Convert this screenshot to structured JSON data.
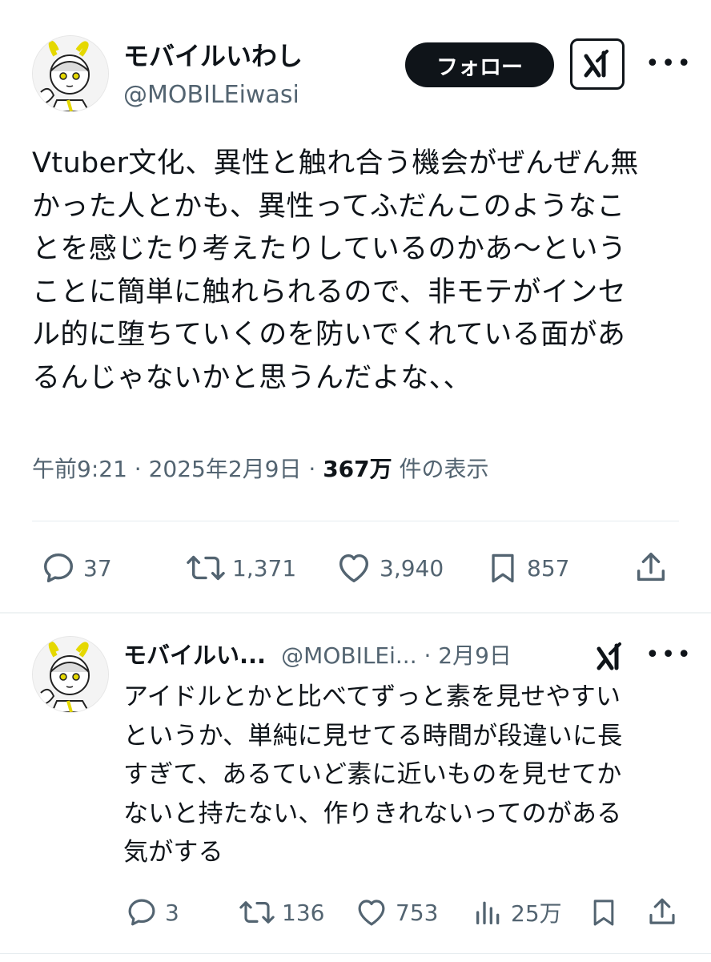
{
  "tweet": {
    "author": {
      "display_name": "モバイルいわし",
      "handle": "@MOBILEiwasi",
      "avatar_icon": "avatar-illustration"
    },
    "follow_label": "フォロー",
    "grok_icon": "grok-icon",
    "more_icon": "more-icon",
    "more_glyph": "•••",
    "text": "Vtuber文化、異性と触れ合う機会がぜんぜん無\nかった人とかも、異性ってふだんこのようなこ\nとを感じたり考えたりしているのかあ〜という\nことに簡単に触れられるので、非モテがインセ\nル的に堕ちていくのを防いでくれている面があ\nるんじゃないかと思うんだよな、、",
    "meta": {
      "time": "午前9:21",
      "sep1": " · ",
      "date": "2025年2月9日",
      "sep2": " · ",
      "views": "367万",
      "views_label": " 件の表示"
    },
    "actions": {
      "replies": "37",
      "retweets": "1,371",
      "likes": "3,940",
      "bookmarks": "857"
    }
  },
  "reply": {
    "author": {
      "display_name": "モバイルい...",
      "handle": "@MOBILEi...",
      "sep": " · ",
      "date": "2月9日"
    },
    "more_glyph": "•••",
    "text": "アイドルとかと比べてずっと素を見せやすい\nというか、単純に見せてる時間が段違いに長\nすぎて、あるていど素に近いものを見せてか\nないと持たない、作りきれないってのがある\n気がする",
    "actions": {
      "replies": "3",
      "retweets": "136",
      "likes": "753",
      "views": "25万"
    }
  },
  "colors": {
    "text": "#0f1419",
    "secondary": "#536471",
    "divider": "#e6ecf0",
    "avatar_accent": "#f2e600"
  }
}
